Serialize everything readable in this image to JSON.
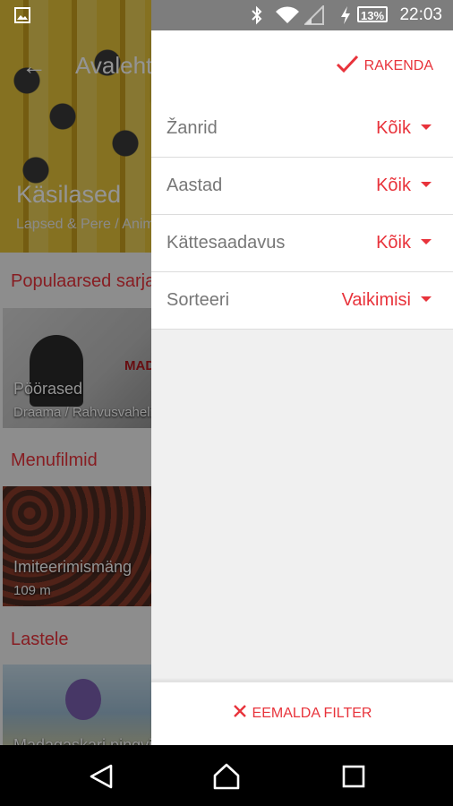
{
  "background": {
    "app_title": "Avaleht",
    "hero": {
      "title": "Käsilased",
      "subtitle": "Lapsed & Pere / Animatsioon"
    },
    "sections": [
      {
        "title": "Populaarsed sarjad",
        "item_title": "Pöörased",
        "item_subtitle": "Draama / Rahvusvaheline",
        "logo": "MAD"
      },
      {
        "title": "Menufilmid",
        "item_title": "Imiteerimismäng",
        "item_subtitle": "109 m"
      },
      {
        "title": "Lastele",
        "item_title": "Madagaskari pingviinid"
      }
    ]
  },
  "status_bar": {
    "time": "22:03",
    "battery": "13%",
    "icons": [
      "image-icon",
      "bluetooth-icon",
      "wifi-icon",
      "signal-icon",
      "charging-icon"
    ]
  },
  "drawer": {
    "apply_label": "RAKENDA",
    "filters": [
      {
        "label": "Žanrid",
        "value": "Kõik"
      },
      {
        "label": "Aastad",
        "value": "Kõik"
      },
      {
        "label": "Kättesaadavus",
        "value": "Kõik"
      },
      {
        "label": "Sorteeri",
        "value": "Vaikimisi"
      }
    ],
    "remove_label": "EEMALDA FILTER"
  },
  "colors": {
    "accent": "#e8333b",
    "status_bar": "#7d7d7d",
    "drawer_bg": "#f0f0f0"
  }
}
